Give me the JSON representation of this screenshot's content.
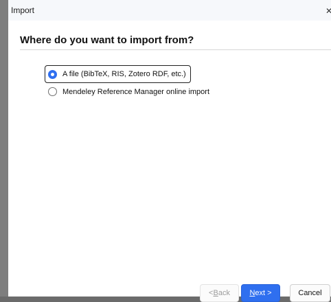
{
  "window": {
    "title": "Import"
  },
  "page": {
    "heading": "Where do you want to import from?"
  },
  "options": [
    {
      "label": "A file (BibTeX, RIS, Zotero RDF, etc.)",
      "selected": true
    },
    {
      "label": "Mendeley Reference Manager online import",
      "selected": false
    }
  ],
  "buttons": {
    "back_prefix": "< ",
    "back_access": "B",
    "back_rest": "ack",
    "next_access": "N",
    "next_rest": "ext >",
    "cancel": "Cancel"
  },
  "colors": {
    "accent": "#2f6fef"
  }
}
